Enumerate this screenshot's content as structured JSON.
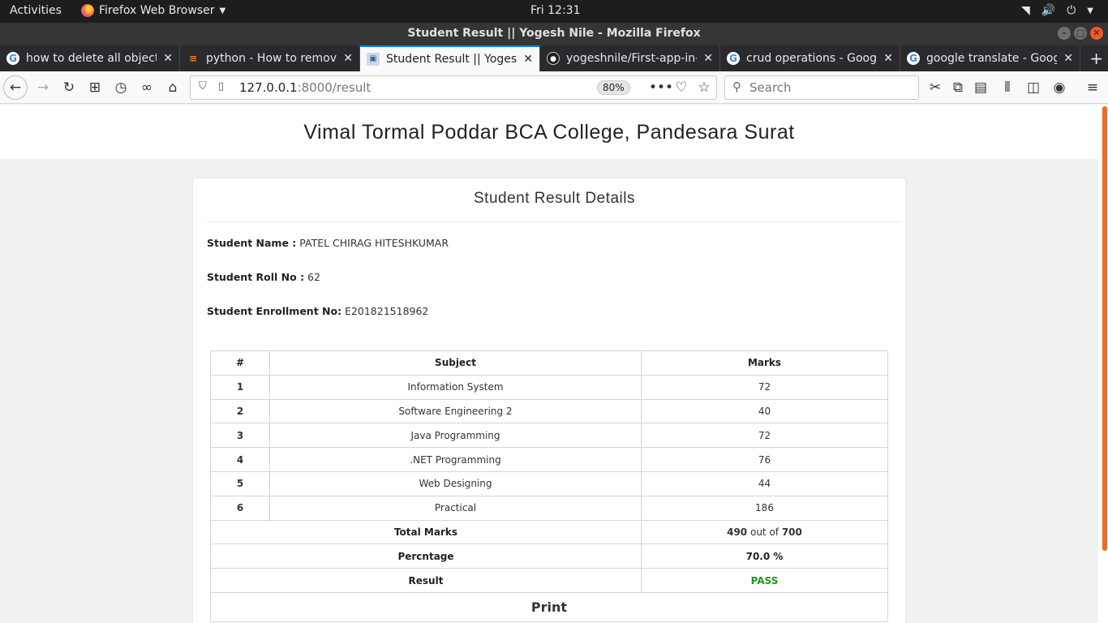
{
  "system": {
    "activities": "Activities",
    "app_name": "Firefox Web Browser",
    "clock": "Fri 12:31"
  },
  "window": {
    "title": "Student Result || Yogesh Nile - Mozilla Firefox"
  },
  "tabs": [
    {
      "title": "how to delete all objects",
      "icon": "google-icon"
    },
    {
      "title": "python - How to remove",
      "icon": "stackoverflow-icon"
    },
    {
      "title": "Student Result || Yogesh",
      "icon": "site-icon"
    },
    {
      "title": "yogeshnile/First-app-in-",
      "icon": "github-icon"
    },
    {
      "title": "crud operations - Google",
      "icon": "google-icon"
    },
    {
      "title": "google translate - Google",
      "icon": "google-icon"
    }
  ],
  "nav": {
    "url_host": "127.0.0.1",
    "url_path": ":8000/result",
    "zoom": "80%",
    "search_placeholder": "Search"
  },
  "page": {
    "college": "Vimal Tormal Poddar BCA College, Pandesara Surat",
    "card_title": "Student Result Details",
    "name_label": "Student Name :",
    "name_value": " PATEL CHIRAG HITESHKUMAR",
    "roll_label": "Student Roll No :",
    "roll_value": " 62",
    "enroll_label": "Student Enrollment No:",
    "enroll_value": " E201821518962",
    "table": {
      "headers": [
        "#",
        "Subject",
        "Marks"
      ],
      "rows": [
        {
          "idx": "1",
          "subject": "Information System",
          "marks": "72"
        },
        {
          "idx": "2",
          "subject": "Software Engineering 2",
          "marks": "40"
        },
        {
          "idx": "3",
          "subject": "Java Programming",
          "marks": "72"
        },
        {
          "idx": "4",
          "subject": ".NET Programming",
          "marks": "76"
        },
        {
          "idx": "5",
          "subject": "Web Designing",
          "marks": "44"
        },
        {
          "idx": "6",
          "subject": "Practical",
          "marks": "186"
        }
      ],
      "total_label": "Total Marks",
      "total_obtained": "490",
      "out_of_text": " out of ",
      "total_max": "700",
      "percentage_label": "Percntage",
      "percentage_value": "70.0 %",
      "result_label": "Result",
      "result_value": "PASS",
      "result_color": "#1a9a1a",
      "print_label": "Print"
    }
  }
}
